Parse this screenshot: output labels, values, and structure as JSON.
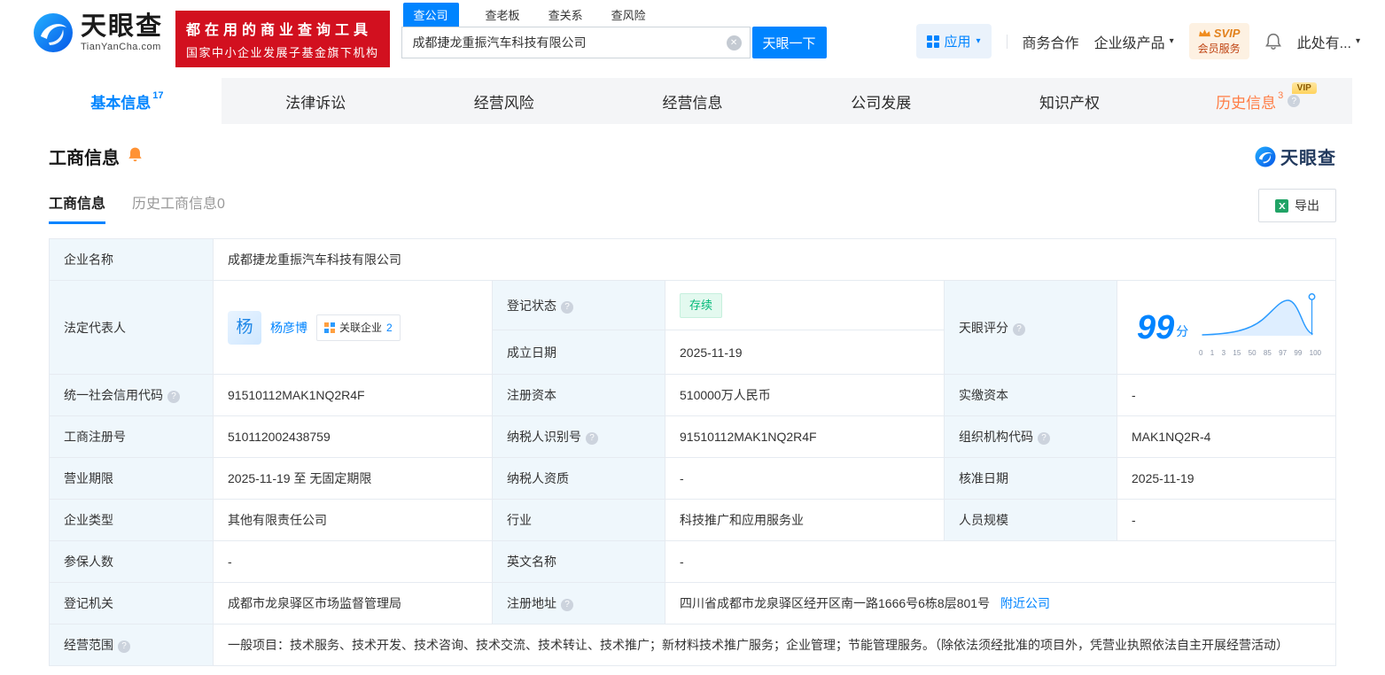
{
  "colors": {
    "brand_blue": "#0084ff",
    "banner_red": "#d2101f",
    "status_green": "#00b977",
    "history_orange": "#ff7d45",
    "vip_gold": "#ffd35e",
    "excel_green": "#21a366"
  },
  "icons": {
    "help": "?",
    "caret": "▾",
    "clear": "✕"
  },
  "header": {
    "logo": {
      "name": "天眼查",
      "domain": "TianYanCha.com"
    },
    "banner": {
      "line1": "都在用的商业查询工具",
      "line2": "国家中小企业发展子基金旗下机构"
    },
    "search": {
      "tabs": [
        {
          "label": "查公司"
        },
        {
          "label": "查老板"
        },
        {
          "label": "查关系"
        },
        {
          "label": "查风险"
        }
      ],
      "value": "成都捷龙重振汽车科技有限公司",
      "button_label": "天眼一下"
    },
    "right": {
      "apps_label": "应用",
      "cooperation_label": "商务合作",
      "enterprise_label": "企业级产品",
      "svip_top": "SVIP",
      "svip_bottom": "会员服务",
      "more_label": "此处有..."
    }
  },
  "nav_tabs": [
    {
      "label": "基本信息",
      "count": "17"
    },
    {
      "label": "法律诉讼"
    },
    {
      "label": "经营风险"
    },
    {
      "label": "经营信息"
    },
    {
      "label": "公司发展"
    },
    {
      "label": "知识产权"
    },
    {
      "label": "历史信息",
      "count": "3",
      "vip": "VIP"
    }
  ],
  "section": {
    "title": "工商信息",
    "brand": "天眼查",
    "sub_tabs": [
      {
        "label": "工商信息"
      },
      {
        "label": "历史工商信息0"
      }
    ],
    "export_label": "导出"
  },
  "fields": {
    "company_name": {
      "label": "企业名称",
      "value": "成都捷龙重振汽车科技有限公司"
    },
    "legal_rep": {
      "label": "法定代表人",
      "avatar": "杨",
      "name": "杨彦博",
      "related": "关联企业",
      "related_count": "2"
    },
    "reg_status": {
      "label": "登记状态",
      "value": "存续"
    },
    "establish_date": {
      "label": "成立日期",
      "value": "2025-11-19"
    },
    "score": {
      "label": "天眼评分",
      "value": "99",
      "unit": "分",
      "axis": [
        "0",
        "1",
        "3",
        "15",
        "50",
        "85",
        "97",
        "99",
        "100"
      ]
    },
    "credit_code": {
      "label": "统一社会信用代码",
      "value": "91510112MAK1NQ2R4F"
    },
    "reg_capital": {
      "label": "注册资本",
      "value": "510000万人民币"
    },
    "paid_capital": {
      "label": "实缴资本",
      "value": "-"
    },
    "reg_number": {
      "label": "工商注册号",
      "value": "510112002438759"
    },
    "taxpayer_id": {
      "label": "纳税人识别号",
      "value": "91510112MAK1NQ2R4F"
    },
    "org_code": {
      "label": "组织机构代码",
      "value": "MAK1NQ2R-4"
    },
    "business_term": {
      "label": "营业期限",
      "value": "2025-11-19 至 无固定期限"
    },
    "taxpayer_quali": {
      "label": "纳税人资质",
      "value": "-"
    },
    "approval_date": {
      "label": "核准日期",
      "value": "2025-11-19"
    },
    "company_type": {
      "label": "企业类型",
      "value": "其他有限责任公司"
    },
    "industry": {
      "label": "行业",
      "value": "科技推广和应用服务业"
    },
    "staff_size": {
      "label": "人员规模",
      "value": "-"
    },
    "insured_count": {
      "label": "参保人数",
      "value": "-"
    },
    "english_name": {
      "label": "英文名称",
      "value": "-"
    },
    "reg_authority": {
      "label": "登记机关",
      "value": "成都市龙泉驿区市场监督管理局"
    },
    "reg_address": {
      "label": "注册地址",
      "value": "四川省成都市龙泉驿区经开区南一路1666号6栋8层801号",
      "link": "附近公司"
    },
    "business_scope": {
      "label": "经营范围",
      "value": "一般项目：技术服务、技术开发、技术咨询、技术交流、技术转让、技术推广；新材料技术推广服务；企业管理；节能管理服务。（除依法须经批准的项目外，凭营业执照依法自主开展经营活动）"
    }
  }
}
